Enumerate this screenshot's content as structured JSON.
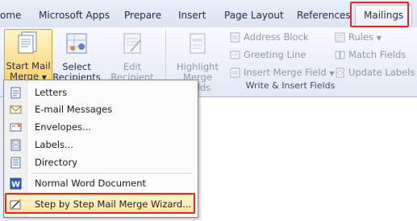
{
  "tabs": [
    "ome",
    "Microsoft Apps",
    "Prepare",
    "Insert",
    "Page Layout",
    "References",
    "Mailings"
  ],
  "ribbon": {
    "start_mail_merge_l1": "Start Mail",
    "start_mail_merge_l2": "Merge",
    "select_recipients_l1": "Select",
    "select_recipients_l2": "Recipients",
    "edit_recipient_l1": "Edit",
    "edit_recipient_l2": "Recipient List",
    "highlight_l1": "Highlight",
    "highlight_l2": "Merge Fields",
    "address_block": "Address Block",
    "greeting_line": "Greeting Line",
    "insert_merge_field": "Insert Merge Field",
    "rules": "Rules",
    "match_fields": "Match Fields",
    "update_labels": "Update Labels",
    "group_label": "Write & Insert Fields"
  },
  "menu": {
    "letters": "Letters",
    "email": "E-mail Messages",
    "envelopes": "Envelopes...",
    "labels": "Labels...",
    "directory": "Directory",
    "normal": "Normal Word Document",
    "wizard": "Step by Step Mail Merge Wizard..."
  },
  "colors": {
    "highlight_border": "#e2262e",
    "hover_fill": "#ffe59a"
  }
}
